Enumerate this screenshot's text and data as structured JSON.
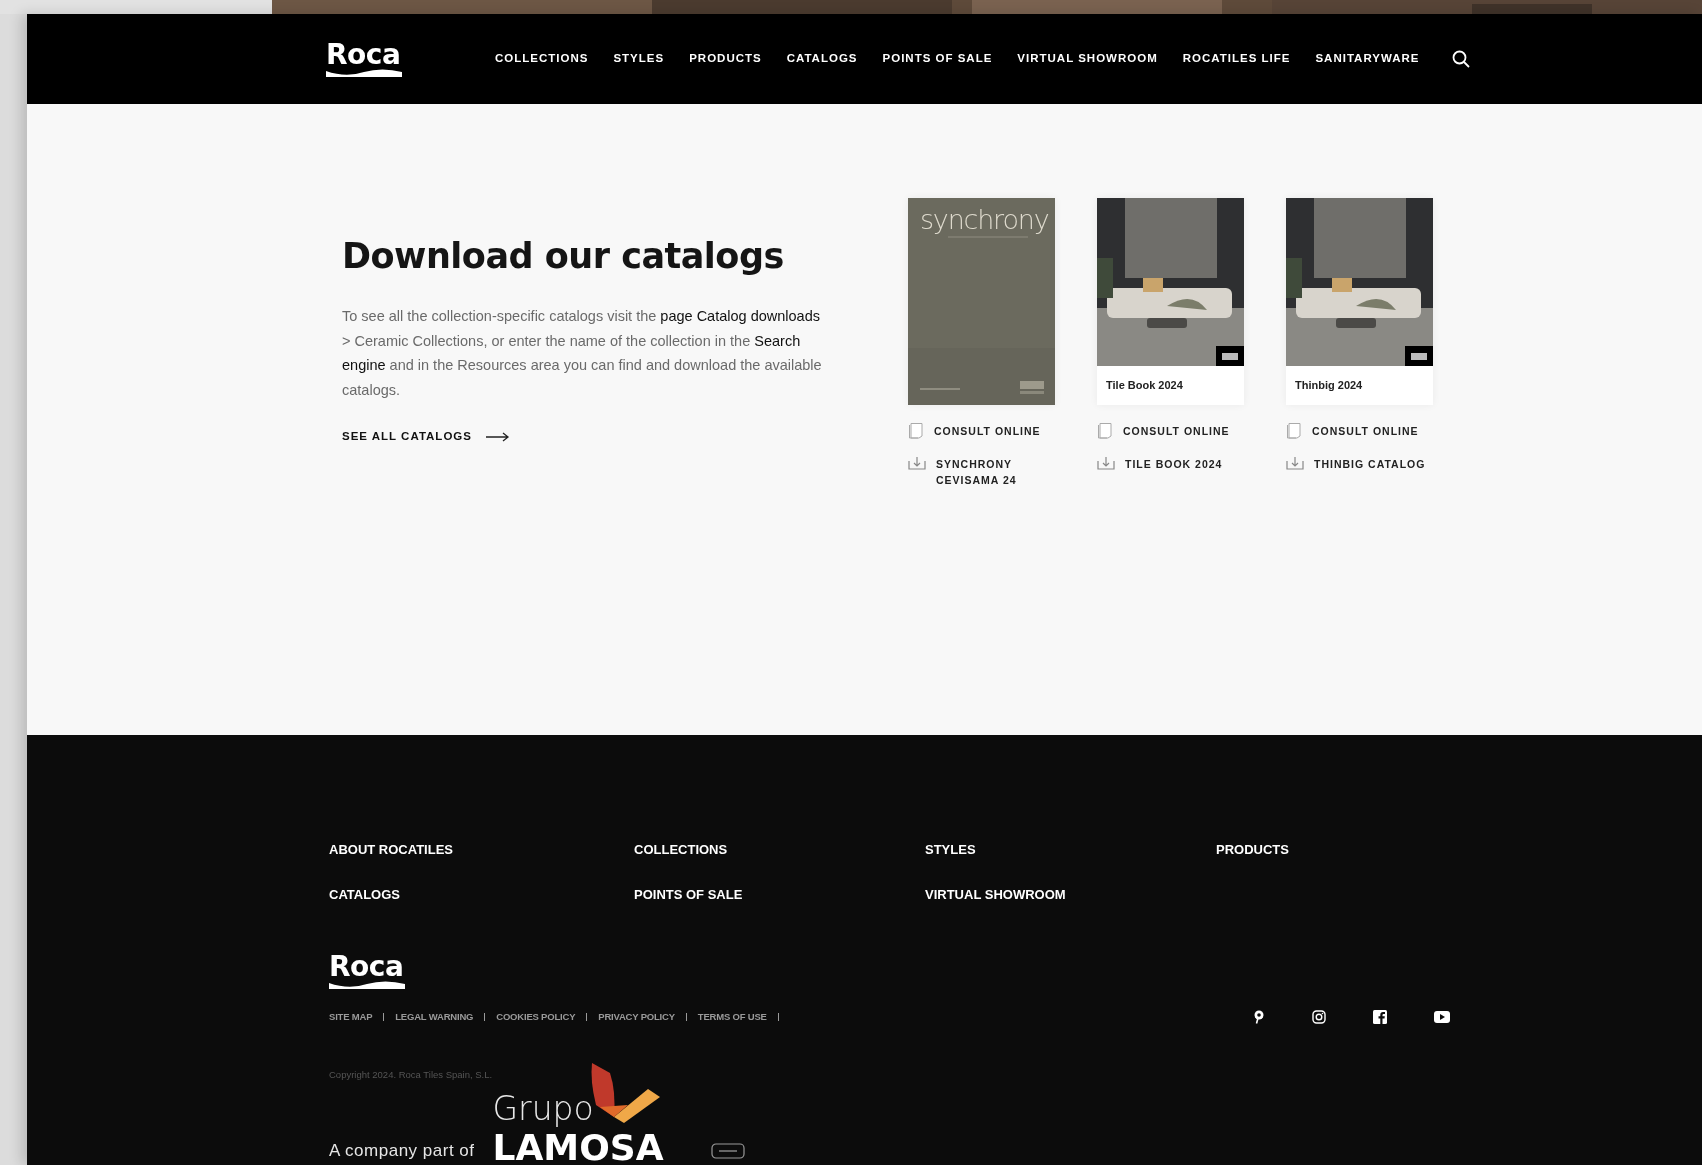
{
  "header": {
    "logo": "Roca",
    "nav": [
      "COLLECTIONS",
      "STYLES",
      "PRODUCTS",
      "CATALOGS",
      "POINTS OF SALE",
      "VIRTUAL SHOWROOM",
      "ROCATILES LIFE",
      "SANITARYWARE"
    ]
  },
  "intro": {
    "title": "Download our catalogs",
    "text": "To see all the collection-specific catalogs visit the **page Catalog downloads** > Ceramic Collections, or enter the name of the collection in the **Search engine** and in the Resources area you can find and download the available catalogs.",
    "link": "SEE ALL CATALOGS"
  },
  "catalogs": [
    {
      "kind": "cover",
      "cover_title": "synchrony",
      "consult": "CONSULT ONLINE",
      "download": "SYNCHRONY CEVISAMA 24"
    },
    {
      "caption": "Tile Book 2024",
      "consult": "CONSULT ONLINE",
      "download": "TILE BOOK 2024"
    },
    {
      "caption": "Thinbig 2024",
      "consult": "CONSULT ONLINE",
      "download": "THINBIG CATALOG"
    }
  ],
  "footer": {
    "columns": [
      [
        "ABOUT ROCATILES",
        "CATALOGS"
      ],
      [
        "COLLECTIONS",
        "POINTS OF SALE"
      ],
      [
        "STYLES",
        "VIRTUAL SHOWROOM"
      ],
      [
        "PRODUCTS"
      ]
    ],
    "logo": "Roca",
    "legal": [
      "SITE MAP",
      "LEGAL WARNING",
      "COOKIES POLICY",
      "PRIVACY POLICY",
      "TERMS OF USE"
    ],
    "copyright": "Copyright 2024. Roca Tiles Spain, S.L.",
    "company_part_of": "A company part of",
    "group_logo": {
      "top": "Grupo",
      "bottom": "LAMOSA"
    }
  }
}
